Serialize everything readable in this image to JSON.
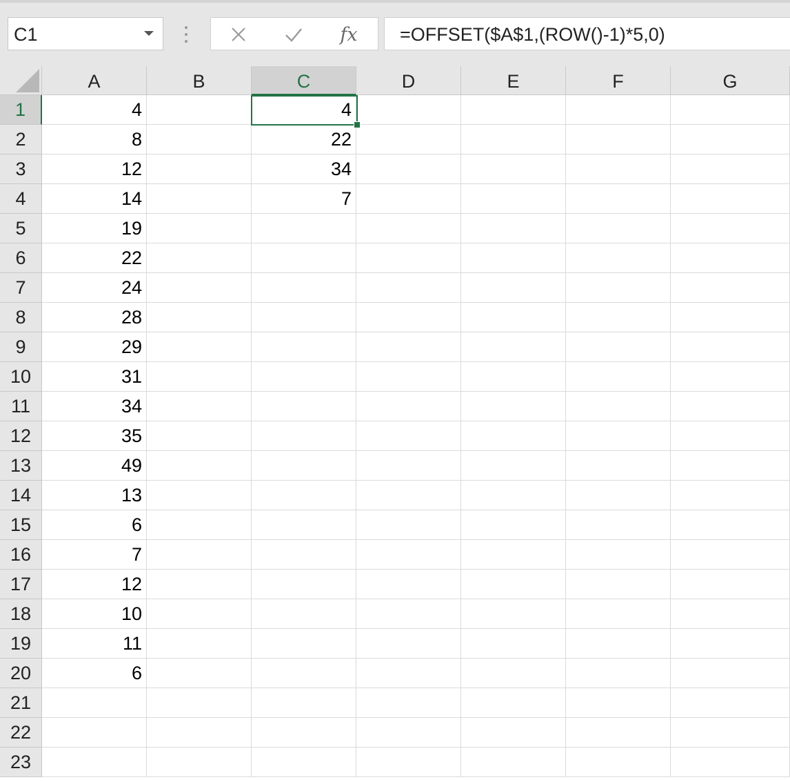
{
  "name_box": {
    "value": "C1",
    "dropdown_icon": "chevron-down-icon"
  },
  "formula_bar": {
    "cancel_icon": "close-icon",
    "enter_icon": "checkmark-icon",
    "fx_label": "fx",
    "formula": "=OFFSET($A$1,(ROW()-1)*5,0)"
  },
  "columns": [
    "A",
    "B",
    "C",
    "D",
    "E",
    "F",
    "G"
  ],
  "selected_column": "C",
  "rows": [
    "1",
    "2",
    "3",
    "4",
    "5",
    "6",
    "7",
    "8",
    "9",
    "10",
    "11",
    "12",
    "13",
    "14",
    "15",
    "16",
    "17",
    "18",
    "19",
    "20",
    "21",
    "22",
    "23"
  ],
  "selected_row": "1",
  "column_a": [
    "4",
    "8",
    "12",
    "14",
    "19",
    "22",
    "24",
    "28",
    "29",
    "31",
    "34",
    "35",
    "49",
    "13",
    "6",
    "7",
    "12",
    "10",
    "11",
    "6"
  ],
  "column_c": [
    "4",
    "22",
    "34",
    "7"
  ],
  "colors": {
    "accent": "#217346",
    "header_bg": "#e6e6e6",
    "selected_header_bg": "#d2d2d2",
    "gridline": "#dadada"
  }
}
